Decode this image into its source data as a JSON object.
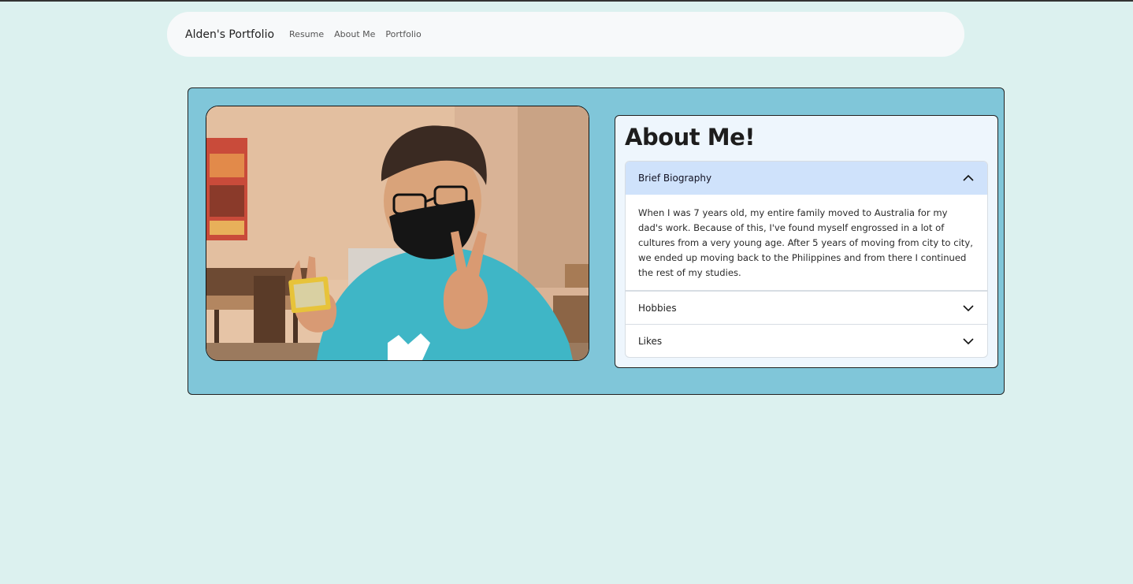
{
  "navbar": {
    "brand": "Alden's Portfolio",
    "links": [
      "Resume",
      "About Me",
      "Portfolio"
    ]
  },
  "about": {
    "title": "About Me!",
    "photo_alt": "Photo of Alden wearing a mask and making peace signs",
    "accordion": [
      {
        "label": "Brief Biography",
        "expanded": true,
        "icon": "chevron-up-icon",
        "body": "When I was 7 years old, my entire family moved to Australia for my dad's work. Because of this, I've found myself engrossed in a lot of cultures from a very young age. After 5 years of moving from city to city, we ended up moving back to the Philippines and from there I continued the rest of my studies."
      },
      {
        "label": "Hobbies",
        "expanded": false,
        "icon": "chevron-down-icon"
      },
      {
        "label": "Likes",
        "expanded": false,
        "icon": "chevron-down-icon"
      }
    ]
  },
  "colors": {
    "page_bg": "#dcf1ef",
    "card_bg": "#80c6d9",
    "panel_bg": "#eef6fd",
    "accordion_active": "#cfe2fb",
    "shirt": "#3fb6c6"
  }
}
